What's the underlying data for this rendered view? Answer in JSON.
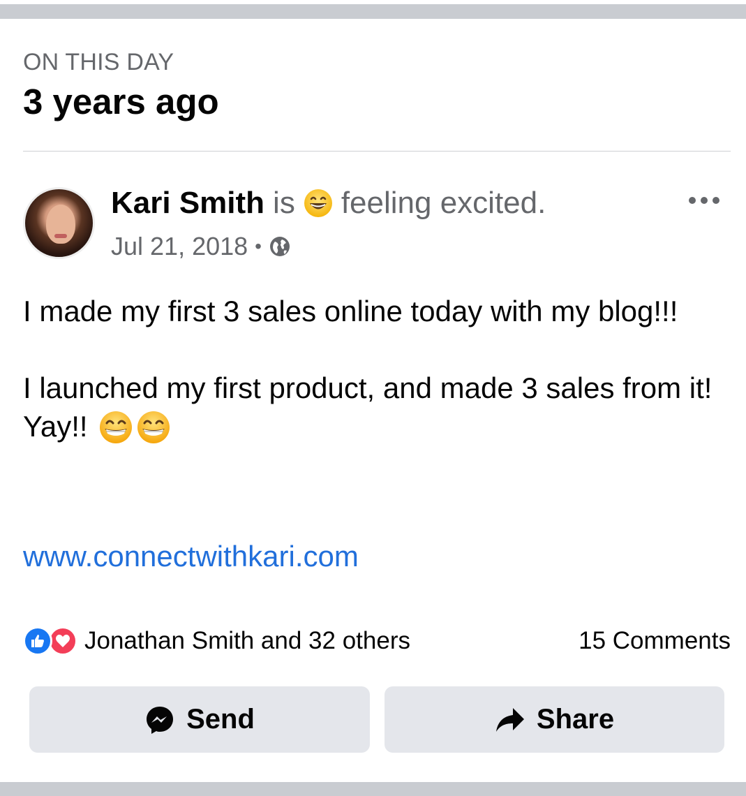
{
  "section": {
    "label": "ON THIS DAY",
    "title": "3 years ago"
  },
  "post": {
    "author": "Kari Smith",
    "is_word": "is",
    "feeling": "feeling excited.",
    "feeling_icon": "grinning-face-emoji",
    "date": "Jul 21, 2018",
    "separator": "•",
    "privacy_icon": "globe-icon",
    "paragraphs": [
      "I made my first 3 sales online today with my blog!!!",
      "I launched my first product, and made 3 sales from it! Yay!!"
    ],
    "link": "www.connectwithkari.com"
  },
  "reactions": {
    "text": "Jonathan Smith and 32 others",
    "comments": "15 Comments",
    "like_color": "#1877f2",
    "love_color": "#f33e58"
  },
  "actions": {
    "send_label": "Send",
    "share_label": "Share"
  },
  "colors": {
    "link": "#216fdb",
    "secondary_text": "#65676b",
    "button_bg": "#e4e6eb"
  }
}
